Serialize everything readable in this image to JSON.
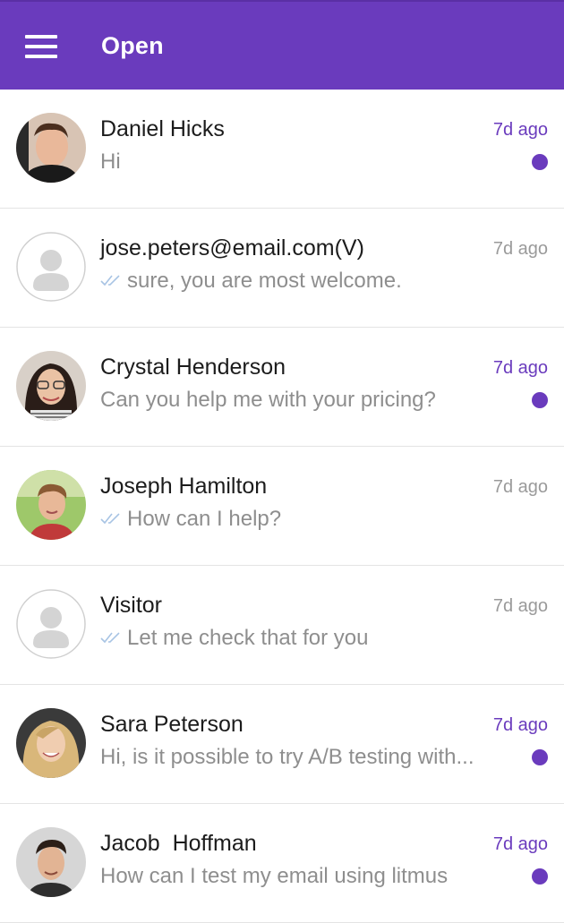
{
  "header": {
    "title": "Open",
    "menu_icon": "hamburger-menu-icon"
  },
  "colors": {
    "accent": "#6a3bbd",
    "unread_dot": "#6a3bbd",
    "read_time": "#9a9a9a"
  },
  "conversations": [
    {
      "name": "Daniel Hicks",
      "message": "Hi",
      "time": "7d ago",
      "unread": true,
      "delivered_check": false,
      "avatar": "photo"
    },
    {
      "name": "jose.peters@email.com(V)",
      "message": "sure, you are most welcome.",
      "time": "7d ago",
      "unread": false,
      "delivered_check": true,
      "avatar": "placeholder"
    },
    {
      "name": "Crystal Henderson",
      "message": "Can you help me with your pricing?",
      "time": "7d ago",
      "unread": true,
      "delivered_check": false,
      "avatar": "photo"
    },
    {
      "name": "Joseph Hamilton",
      "message": "How can I help?",
      "time": "7d ago",
      "unread": false,
      "delivered_check": true,
      "avatar": "photo"
    },
    {
      "name": "Visitor",
      "message": "Let me check that for you",
      "time": "7d ago",
      "unread": false,
      "delivered_check": true,
      "avatar": "placeholder"
    },
    {
      "name": "Sara Peterson",
      "message": "Hi, is it possible to try A/B testing with...",
      "time": "7d ago",
      "unread": true,
      "delivered_check": false,
      "avatar": "photo"
    },
    {
      "name": "Jacob  Hoffman",
      "message": "How can I test my email using litmus",
      "time": "7d ago",
      "unread": true,
      "delivered_check": false,
      "avatar": "photo"
    }
  ]
}
